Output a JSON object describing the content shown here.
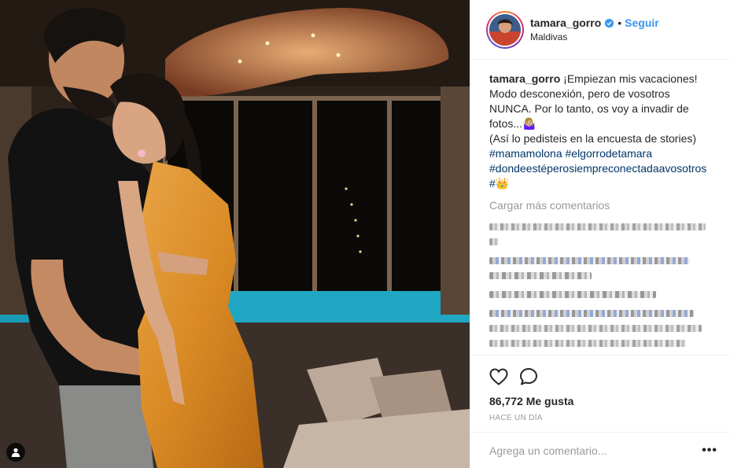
{
  "post": {
    "username": "tamara_gorro",
    "follow_label": "Seguir",
    "location": "Maldivas",
    "caption_text": "¡Empiezan mis vacaciones! Modo desconexión, pero de vosotros NUNCA. Por lo tanto, os voy a invadir de fotos...🤷🏼‍♀️\n(Así lo pedisteis en la encuesta de stories)",
    "hashtags": [
      "#mamamolona",
      "#elgorrodetamara",
      "#dondeestéperosiempreconectadaavosotros",
      "#👑"
    ],
    "load_more_label": "Cargar más comentarios",
    "likes": "86,772 Me gusta",
    "time": "HACE UN DÍA",
    "comment_placeholder": "Agrega un comentario...",
    "more_options": "•••"
  },
  "icons": {
    "verified": "verified-badge-icon",
    "like": "heart-icon",
    "comment": "comment-icon",
    "tag": "user-tag-icon",
    "more": "more-options-icon"
  },
  "colors": {
    "link": "#3897f0",
    "hashtag": "#003569",
    "muted": "#999999",
    "divider": "#efefef"
  }
}
